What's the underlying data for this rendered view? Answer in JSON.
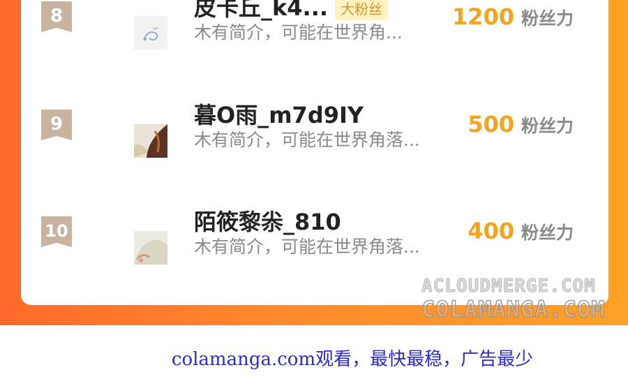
{
  "leaderboard": {
    "rows": [
      {
        "rank": "8",
        "name": "皮卡丘_k4...",
        "badge": "大粉丝",
        "bio": "木有简介，可能在世界角...",
        "score": "1200",
        "unit": "粉丝力"
      },
      {
        "rank": "9",
        "name": "暮O雨_m7d9IY",
        "badge": "",
        "bio": "木有简介，可能在世界角落...",
        "score": "500",
        "unit": "粉丝力"
      },
      {
        "rank": "10",
        "name": "陌筱黎尜_810",
        "badge": "",
        "bio": "木有简介，可能在世界角落...",
        "score": "400",
        "unit": "粉丝力"
      }
    ]
  },
  "watermark": {
    "line1": "ACLOUDMERGE.COM",
    "line2": "COLAMANGA.COM"
  },
  "footer": {
    "text": "colamanga.com观看，最快最稳，广告最少"
  },
  "colors": {
    "background_band": "#ff8a2d",
    "score": "#f3a51d",
    "rank_badge": "#c8b2a0",
    "footer_link": "#2b2bd6"
  }
}
